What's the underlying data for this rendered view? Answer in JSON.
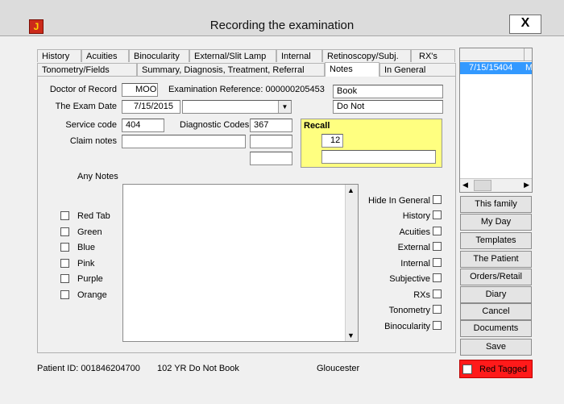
{
  "window": {
    "title": "Recording the examination",
    "close_label": "X",
    "app_icon_glyph": "J"
  },
  "tabs_row1": [
    "History",
    "Acuities",
    "Binocularity",
    "External/Slit Lamp",
    "Internal",
    "Retinoscopy/Subj.",
    "RX's"
  ],
  "tabs_row2": [
    "Tonometry/Fields",
    "Summary, Diagnosis, Treatment, Referral",
    "Notes",
    "In General"
  ],
  "active_tab": "Notes",
  "form": {
    "doctor_label": "Doctor of Record",
    "doctor_value": "MOO",
    "exam_ref_label": "Examination Reference:",
    "exam_ref_value": "000000205453",
    "exam_date_label": "The Exam Date",
    "exam_date_value": "7/15/2015",
    "service_code_label": "Service code",
    "service_code_value": "404",
    "diag_codes_label": "Diagnostic Codes",
    "diag_codes_value": "367",
    "claim_notes_label": "Claim notes",
    "claim_notes_value": "",
    "book_value": "Book",
    "donot_value": "Do Not",
    "any_notes_label": "Any Notes",
    "notes_value": ""
  },
  "recall": {
    "label": "Recall",
    "value": "12",
    "extra_value": ""
  },
  "color_tags": [
    "Red Tab",
    "Green",
    "Blue",
    "Pink",
    "Purple",
    "Orange"
  ],
  "hide_flags": [
    "Hide In General",
    "History",
    "Acuities",
    "External",
    "Internal",
    "Subjective",
    "RXs",
    "Tonometry",
    "Binocularity"
  ],
  "visits": [
    {
      "date": "7/15/15",
      "code": "404",
      "flag": "M"
    }
  ],
  "side_buttons": [
    "This family",
    "My Day",
    "Templates",
    "The Patient",
    "Orders/Retail",
    "Diary",
    "Cancel",
    "Documents",
    "Save"
  ],
  "status": {
    "patient_id": "Patient ID: 001846204700",
    "age_status": "102 YR  Do Not Book",
    "location": "Gloucester"
  },
  "red_tagged_label": "Red Tagged",
  "colors": {
    "recall_bg": "#ffff80",
    "selection": "#3399ff",
    "red_tag": "#ff1a1a"
  }
}
